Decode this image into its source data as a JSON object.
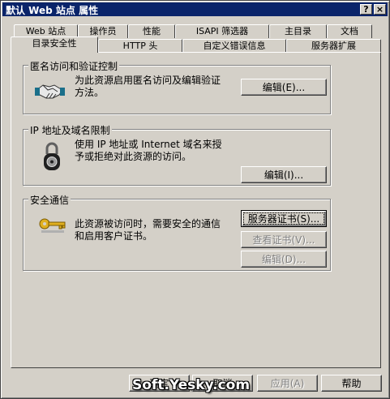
{
  "window": {
    "title": "默认 Web 站点 属性",
    "help_button": "?",
    "close_button": "×"
  },
  "tabs_row1": [
    "Web 站点",
    "操作员",
    "性能",
    "ISAPI 筛选器",
    "主目录",
    "文档"
  ],
  "tabs_row2": [
    "目录安全性",
    "HTTP 头",
    "自定义错误信息",
    "服务器扩展"
  ],
  "active_tab": "目录安全性",
  "groups": {
    "anonymous": {
      "title": "匿名访问和验证控制",
      "desc": "为此资源启用匿名访问及编辑验证方法。",
      "button": "编辑(E)...",
      "icon": "handshake-icon"
    },
    "ip": {
      "title": "IP 地址及域名限制",
      "desc": "使用 IP 地址或 Internet 域名来授予或拒绝对此资源的访问。",
      "button": "编辑(I)...",
      "icon": "padlock-icon"
    },
    "secure": {
      "title": "安全通信",
      "desc": "此资源被访问时，需要安全的通信和启用客户证书。",
      "buttons": {
        "server_cert": "服务器证书(S)...",
        "view_cert": "查看证书(V)...",
        "edit": "编辑(D)..."
      },
      "icon": "key-icon"
    }
  },
  "footer": {
    "ok": "确定",
    "cancel": "取消",
    "apply": "应用(A)",
    "help": "帮助"
  },
  "watermark": "Soft.Yesky.com",
  "colors": {
    "face": "#d4d0c8",
    "titlebar": "#0a246a",
    "shadow": "#808080",
    "highlight": "#ffffff"
  }
}
